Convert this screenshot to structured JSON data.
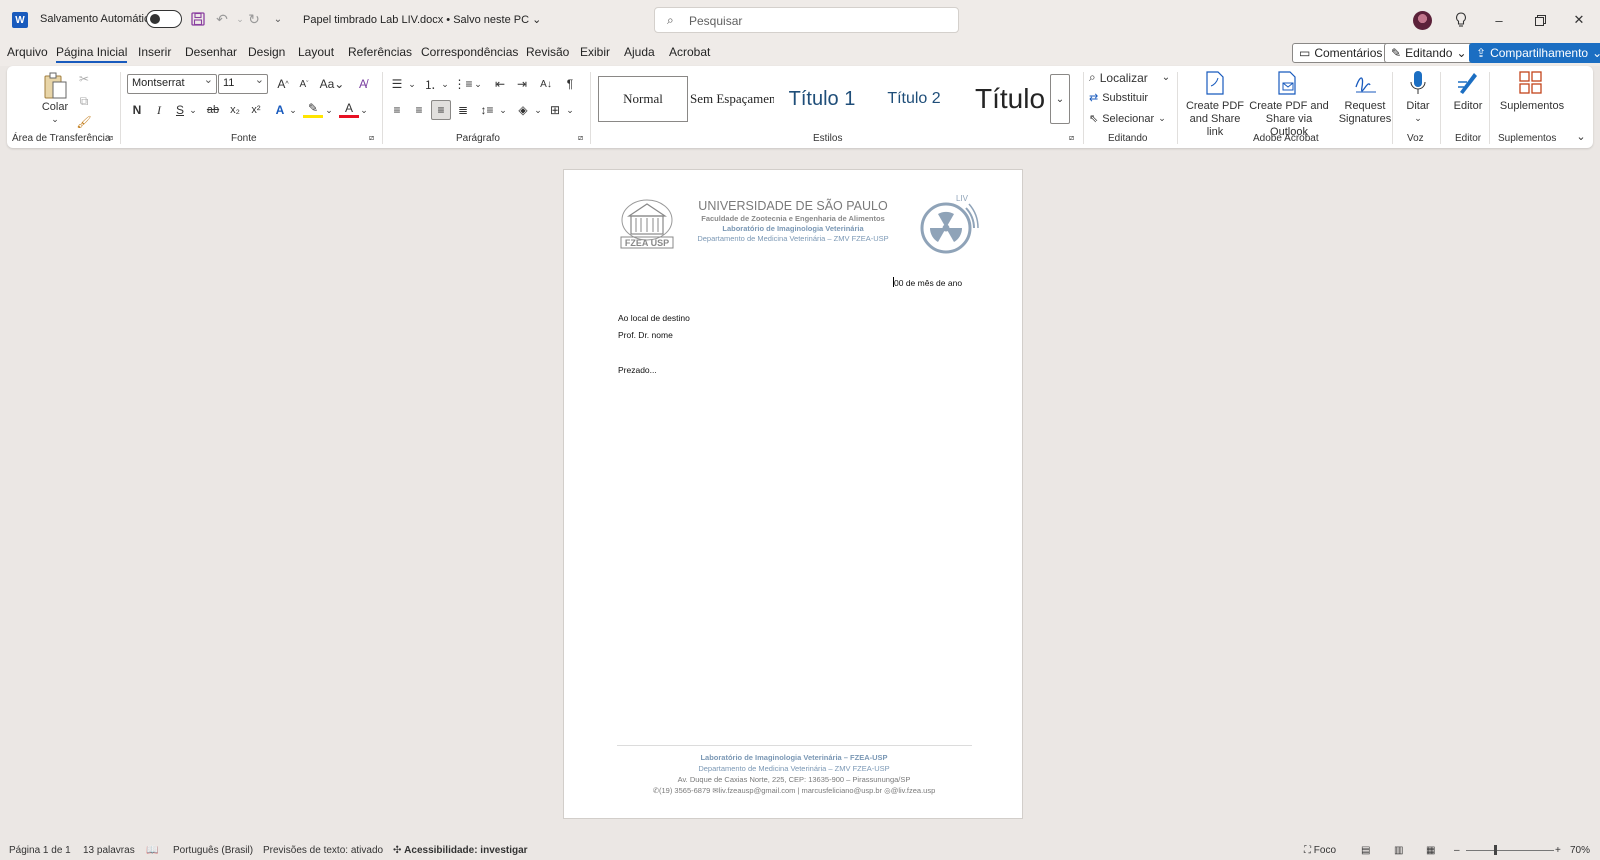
{
  "titlebar": {
    "app_icon": "W",
    "autosave_label": "Salvamento Automático",
    "autosave_state": "off",
    "doc_title": "Papel timbrado Lab LIV.docx • Salvo neste PC",
    "search_placeholder": "Pesquisar"
  },
  "menu": {
    "items": [
      "Arquivo",
      "Página Inicial",
      "Inserir",
      "Desenhar",
      "Design",
      "Layout",
      "Referências",
      "Correspondências",
      "Revisão",
      "Exibir",
      "Ajuda",
      "Acrobat"
    ],
    "active": "Página Inicial",
    "comments_label": "Comentários",
    "editing_label": "Editando",
    "share_label": "Compartilhamento"
  },
  "ribbon": {
    "clipboard": {
      "paste_label": "Colar",
      "group_label": "Área de Transferência"
    },
    "font": {
      "font_name": "Montserrat",
      "font_size": "11",
      "bold": "N",
      "italic": "I",
      "underline": "S",
      "group_label": "Fonte"
    },
    "paragraph": {
      "group_label": "Parágrafo"
    },
    "styles": {
      "items": [
        "Normal",
        "Sem Espaçamento",
        "Título 1",
        "Título 2",
        "Título"
      ],
      "group_label": "Estilos"
    },
    "editing": {
      "find": "Localizar",
      "replace": "Substituir",
      "select": "Selecionar",
      "group_label": "Editando"
    },
    "acrobat": {
      "create_pdf_link": [
        "Create PDF",
        "and Share link"
      ],
      "create_pdf_outlook": [
        "Create PDF and",
        "Share via Outlook"
      ],
      "request_signatures": [
        "Request",
        "Signatures"
      ],
      "group_label": "Adobe Acrobat"
    },
    "voice": {
      "dictate": "Ditar",
      "group_label": "Voz"
    },
    "editor": {
      "editor": "Editor",
      "group_label": "Editor"
    },
    "addins": {
      "label": "Suplementos",
      "group_label": "Suplementos"
    }
  },
  "document": {
    "header": {
      "university": "UNIVERSIDADE DE SÃO PAULO",
      "faculty": "Faculdade de Zootecnia e Engenharia de Alimentos",
      "lab": "Laboratório de Imaginologia Veterinária",
      "department": "Departamento de Medicina Veterinária – ZMV FZEA-USP",
      "usp_logo_text": "FZEA USP",
      "liv_logo_text": "LIV"
    },
    "date_line": "00 de mês de ano",
    "recipient_line1": "Ao local de destino",
    "recipient_line2": "Prof. Dr. nome",
    "salutation": "Prezado...",
    "footer": {
      "lab": "Laboratório de Imaginologia Veterinária – FZEA-USP",
      "department": "Departamento de Medicina Veterinária – ZMV FZEA-USP",
      "address": "Av. Duque de Caxias Norte, 225, CEP: 13635-900 – Pirassununga/SP",
      "phone": "(19) 3565-6879",
      "emails": "liv.fzeausp@gmail.com | marcusfeliciano@usp.br",
      "instagram": "@liv.fzea.usp"
    }
  },
  "status": {
    "page": "Página 1 de 1",
    "words": "13 palavras",
    "language": "Português (Brasil)",
    "predictions": "Previsões de texto: ativado",
    "accessibility": "Acessibilidade: investigar",
    "focus": "Foco",
    "zoom": "70%",
    "zoom_level": 0.7
  },
  "colors": {
    "accent": "#185abd",
    "share_button": "#1b6ec2",
    "header_gray": "#7a7a7a",
    "lab_blue": "#7b98b5"
  }
}
